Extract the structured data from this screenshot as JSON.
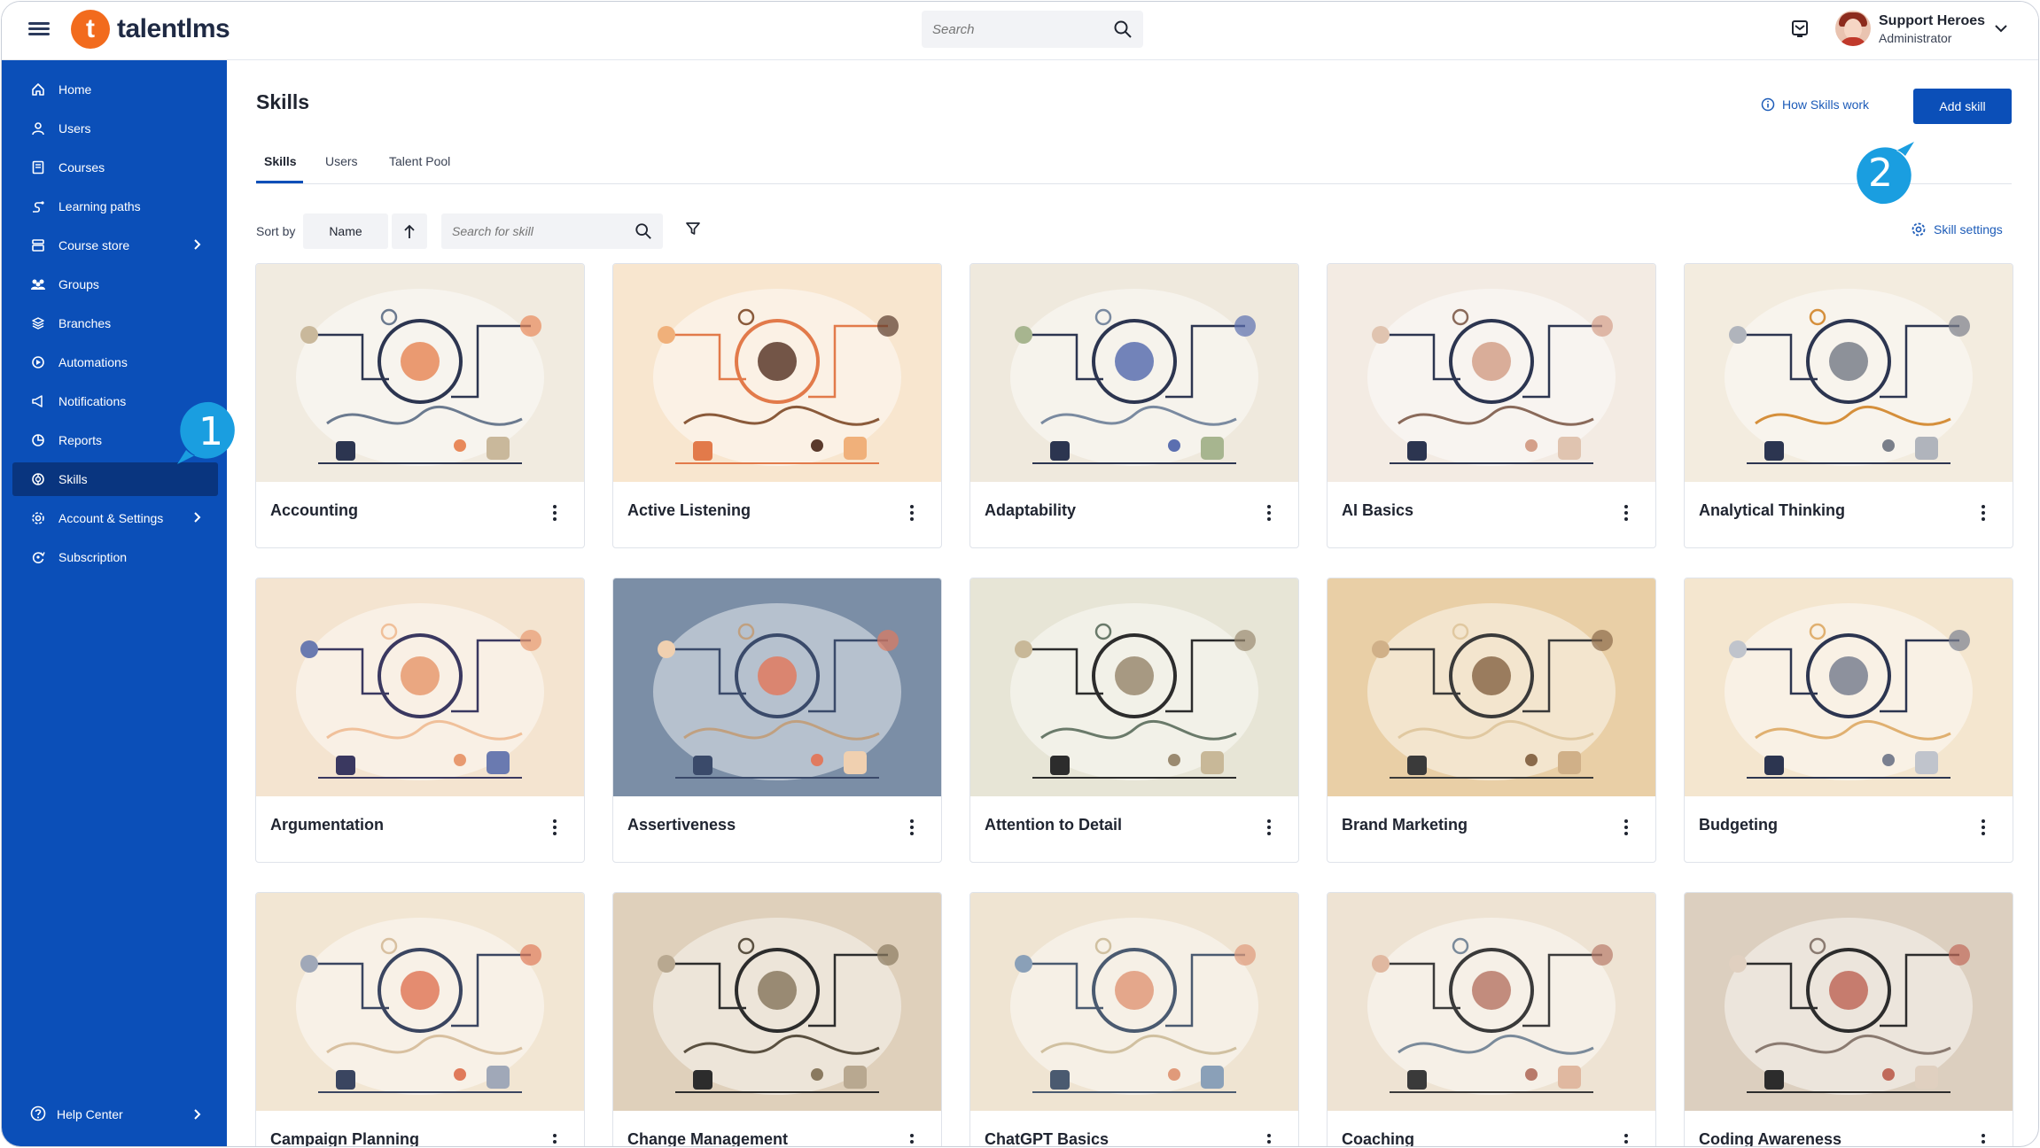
{
  "app": {
    "logo_text": "talentlms",
    "logo_letter": "t"
  },
  "header": {
    "search_placeholder": "Search",
    "user_name": "Support Heroes",
    "user_role": "Administrator"
  },
  "sidebar": {
    "items": [
      {
        "label": "Home",
        "icon": "home-icon"
      },
      {
        "label": "Users",
        "icon": "user-icon"
      },
      {
        "label": "Courses",
        "icon": "book-icon"
      },
      {
        "label": "Learning paths",
        "icon": "path-icon"
      },
      {
        "label": "Course store",
        "icon": "store-icon"
      },
      {
        "label": "Groups",
        "icon": "groups-icon"
      },
      {
        "label": "Branches",
        "icon": "branches-icon"
      },
      {
        "label": "Automations",
        "icon": "automations-icon"
      },
      {
        "label": "Notifications",
        "icon": "megaphone-icon"
      },
      {
        "label": "Reports",
        "icon": "pie-chart-icon"
      },
      {
        "label": "Skills",
        "icon": "skills-icon"
      },
      {
        "label": "Account & Settings",
        "icon": "gear-icon"
      },
      {
        "label": "Subscription",
        "icon": "subscription-icon"
      }
    ],
    "help_label": "Help Center"
  },
  "main": {
    "title": "Skills",
    "how_link": "How Skills work",
    "add_button": "Add skill",
    "tabs": [
      "Skills",
      "Users",
      "Talent Pool"
    ],
    "sort_label": "Sort by",
    "sort_value": "Name",
    "search_placeholder": "Search for skill",
    "settings_link": "Skill settings"
  },
  "skills": [
    {
      "name": "Accounting",
      "bg": "#f1ebe0"
    },
    {
      "name": "Active Listening",
      "bg": "#f8e6cf"
    },
    {
      "name": "Adaptability",
      "bg": "#efe9dd"
    },
    {
      "name": "AI Basics",
      "bg": "#f3ebe3"
    },
    {
      "name": "Analytical Thinking",
      "bg": "#f3ecdf"
    },
    {
      "name": "Argumentation",
      "bg": "#f4e4d0"
    },
    {
      "name": "Assertiveness",
      "bg": "#7b8ea6"
    },
    {
      "name": "Attention to Detail",
      "bg": "#e7e5d6"
    },
    {
      "name": "Brand Marketing",
      "bg": "#e9cfa6"
    },
    {
      "name": "Budgeting",
      "bg": "#f4e6cf"
    },
    {
      "name": "Campaign Planning",
      "bg": "#f2e6d3"
    },
    {
      "name": "Change Management",
      "bg": "#dfd0bb"
    },
    {
      "name": "ChatGPT Basics",
      "bg": "#efe4d2"
    },
    {
      "name": "Coaching",
      "bg": "#eee3d3"
    },
    {
      "name": "Coding Awareness",
      "bg": "#dccfbf"
    }
  ],
  "callouts": [
    "1",
    "2"
  ],
  "colors": {
    "primary": "#0b4fb8",
    "primary_dark": "#09357f",
    "callout": "#1a9ee0",
    "accent": "#f26b1d"
  }
}
